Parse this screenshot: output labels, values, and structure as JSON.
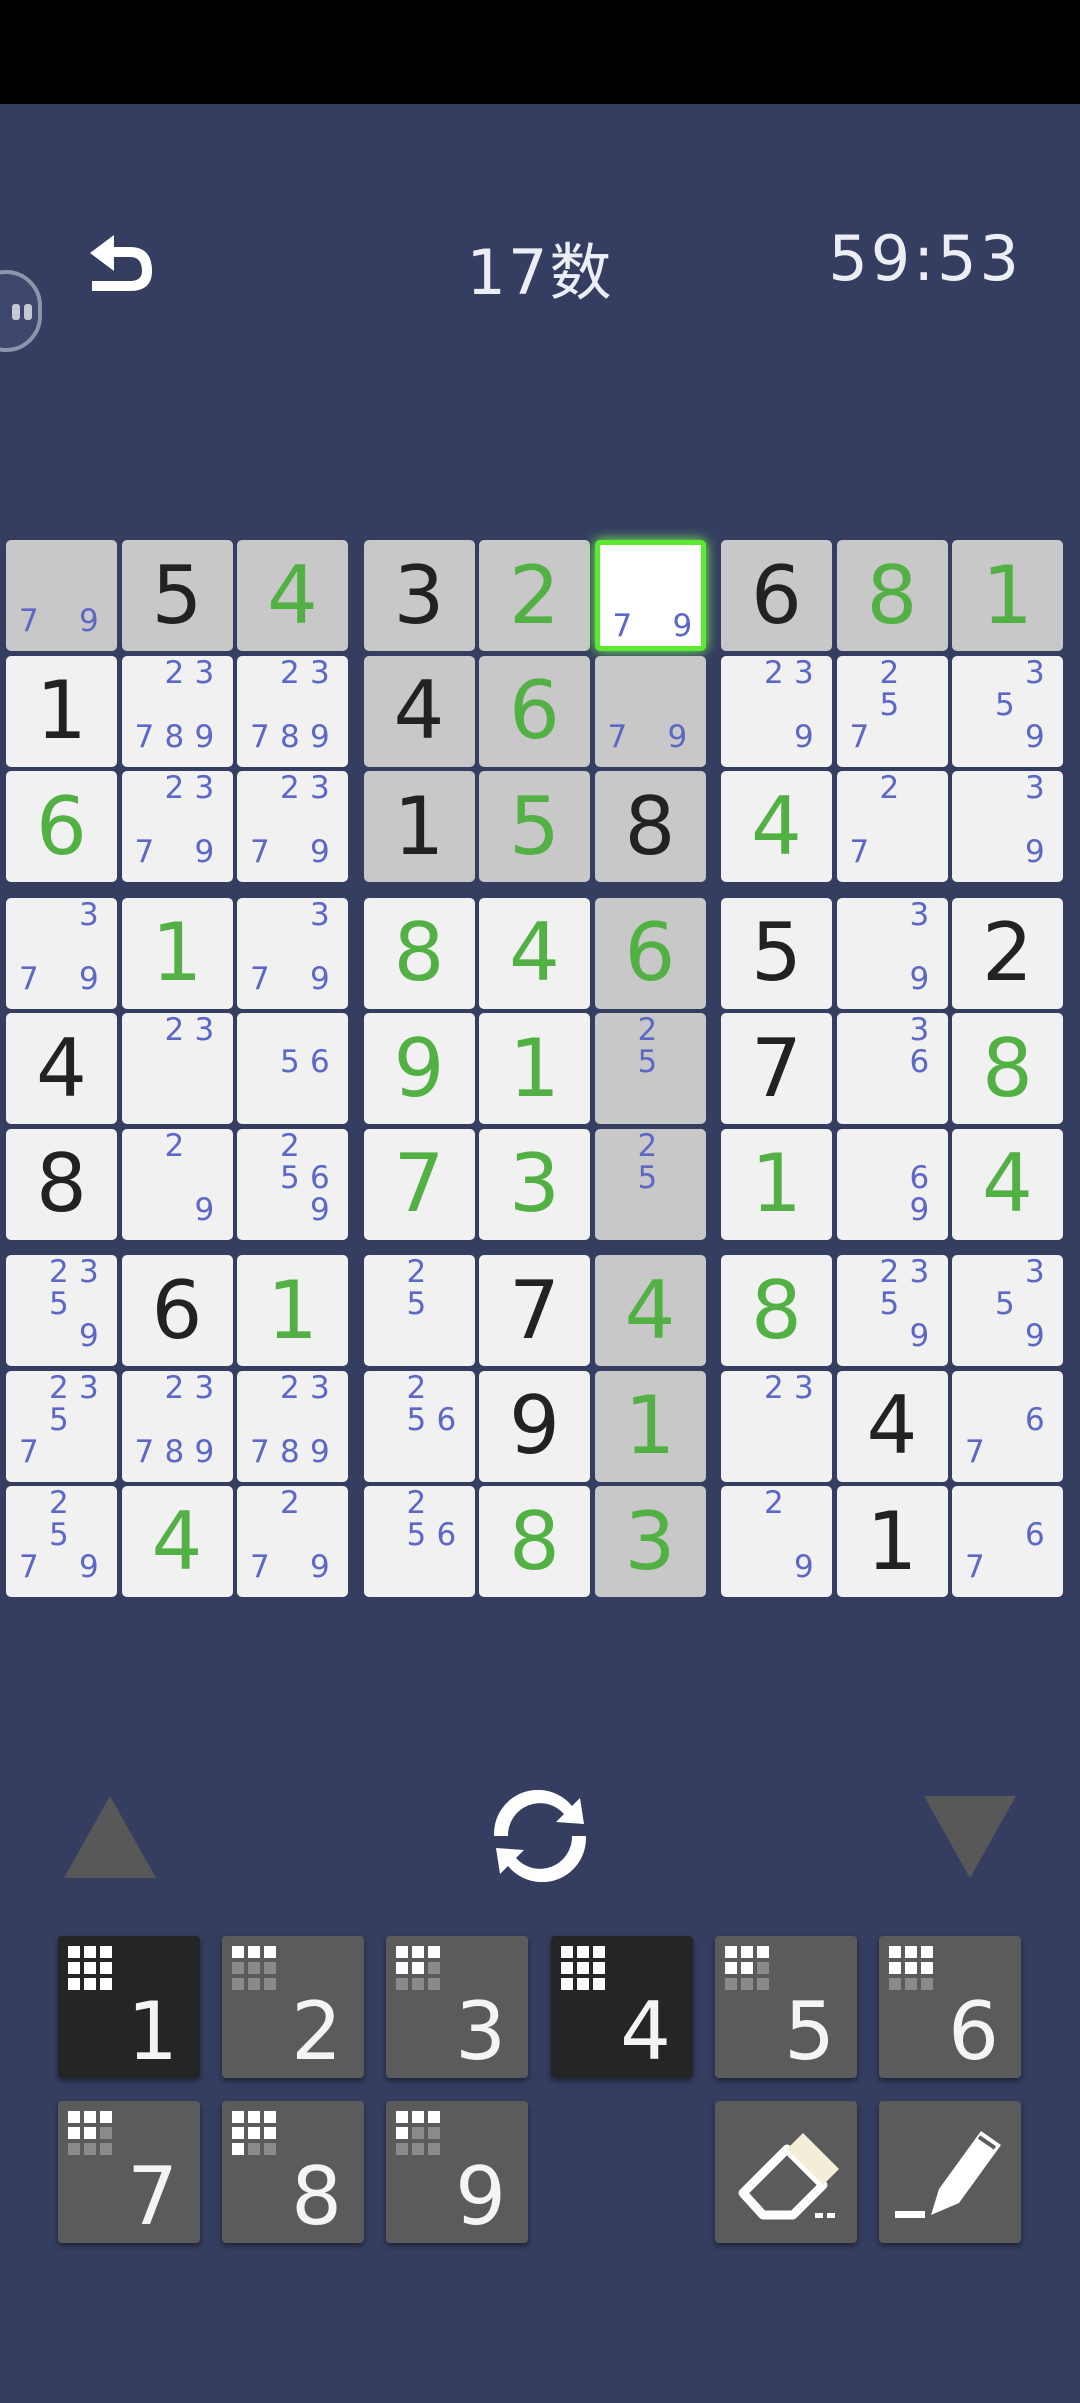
{
  "header": {
    "title": "17数",
    "timer": "59:53",
    "back_icon": "undo-arrow-icon",
    "side_icon": "floating-handle-icon"
  },
  "colors": {
    "background": "#353e61",
    "given_digit": "#222222",
    "player_digit": "#53b044",
    "candidate": "#5d68c5",
    "selected_border": "#5cea30"
  },
  "board": {
    "selected": [
      0,
      5
    ],
    "highlight_digit": "4",
    "grid": [
      [
        {
          "c": [
            7,
            9
          ],
          "s": 1
        },
        {
          "v": "5",
          "s": 1
        },
        {
          "v": "4",
          "p": 1,
          "s": 1
        },
        {
          "v": "3",
          "s": 1
        },
        {
          "v": "2",
          "p": 1,
          "s": 1
        },
        {
          "c": [
            7,
            9
          ],
          "sel": 1
        },
        {
          "v": "6",
          "s": 1
        },
        {
          "v": "8",
          "p": 1,
          "s": 1
        },
        {
          "v": "1",
          "p": 1,
          "s": 1
        }
      ],
      [
        {
          "v": "1"
        },
        {
          "c": [
            2,
            3,
            7,
            8,
            9
          ]
        },
        {
          "c": [
            2,
            3,
            7,
            8,
            9
          ]
        },
        {
          "v": "4",
          "s": 1
        },
        {
          "v": "6",
          "p": 1,
          "s": 1
        },
        {
          "c": [
            7,
            9
          ],
          "s": 1
        },
        {
          "c": [
            2,
            3,
            9
          ]
        },
        {
          "c": [
            2,
            5,
            7
          ]
        },
        {
          "c": [
            3,
            5,
            9
          ]
        }
      ],
      [
        {
          "v": "6",
          "p": 1
        },
        {
          "c": [
            2,
            3,
            7,
            9
          ]
        },
        {
          "c": [
            2,
            3,
            7,
            9
          ]
        },
        {
          "v": "1",
          "s": 1
        },
        {
          "v": "5",
          "p": 1,
          "s": 1
        },
        {
          "v": "8",
          "s": 1
        },
        {
          "v": "4",
          "p": 1
        },
        {
          "c": [
            2,
            7
          ]
        },
        {
          "c": [
            3,
            9
          ]
        }
      ],
      [
        {
          "c": [
            3,
            7,
            9
          ]
        },
        {
          "v": "1",
          "p": 1
        },
        {
          "c": [
            3,
            7,
            9
          ]
        },
        {
          "v": "8",
          "p": 1
        },
        {
          "v": "4",
          "p": 1
        },
        {
          "v": "6",
          "p": 1,
          "s": 1
        },
        {
          "v": "5"
        },
        {
          "c": [
            3,
            9
          ]
        },
        {
          "v": "2"
        }
      ],
      [
        {
          "v": "4"
        },
        {
          "c": [
            2,
            3
          ]
        },
        {
          "c": [
            5,
            6
          ]
        },
        {
          "v": "9",
          "p": 1
        },
        {
          "v": "1",
          "p": 1
        },
        {
          "c": [
            2,
            5
          ],
          "s": 1
        },
        {
          "v": "7"
        },
        {
          "c": [
            3,
            6
          ]
        },
        {
          "v": "8",
          "p": 1
        }
      ],
      [
        {
          "v": "8"
        },
        {
          "c": [
            2,
            9
          ]
        },
        {
          "c": [
            2,
            5,
            6,
            9
          ]
        },
        {
          "v": "7",
          "p": 1
        },
        {
          "v": "3",
          "p": 1
        },
        {
          "c": [
            2,
            5
          ],
          "s": 1
        },
        {
          "v": "1",
          "p": 1
        },
        {
          "c": [
            6,
            9
          ]
        },
        {
          "v": "4",
          "p": 1
        }
      ],
      [
        {
          "c": [
            2,
            3,
            5,
            9
          ]
        },
        {
          "v": "6"
        },
        {
          "v": "1",
          "p": 1
        },
        {
          "c": [
            2,
            5
          ]
        },
        {
          "v": "7"
        },
        {
          "v": "4",
          "p": 1,
          "s": 1
        },
        {
          "v": "8",
          "p": 1
        },
        {
          "c": [
            2,
            3,
            5,
            9
          ]
        },
        {
          "c": [
            3,
            5,
            9
          ]
        }
      ],
      [
        {
          "c": [
            2,
            3,
            5,
            7
          ]
        },
        {
          "c": [
            2,
            3,
            7,
            8,
            9
          ]
        },
        {
          "c": [
            2,
            3,
            7,
            8,
            9
          ]
        },
        {
          "c": [
            2,
            5,
            6
          ]
        },
        {
          "v": "9"
        },
        {
          "v": "1",
          "p": 1,
          "s": 1
        },
        {
          "c": [
            2,
            3
          ]
        },
        {
          "v": "4"
        },
        {
          "c": [
            6,
            7
          ]
        }
      ],
      [
        {
          "c": [
            2,
            5,
            7,
            9
          ]
        },
        {
          "v": "4",
          "p": 1
        },
        {
          "c": [
            2,
            7,
            9
          ]
        },
        {
          "c": [
            2,
            5,
            6
          ]
        },
        {
          "v": "8",
          "p": 1
        },
        {
          "v": "3",
          "p": 1,
          "s": 1
        },
        {
          "c": [
            2,
            9
          ]
        },
        {
          "v": "1"
        },
        {
          "c": [
            6,
            7
          ]
        }
      ]
    ]
  },
  "controls": {
    "up_icon": "triangle-up-icon",
    "cycle_icon": "refresh-cycle-icon",
    "down_icon": "triangle-down-icon"
  },
  "number_pad": [
    {
      "label": "1",
      "remaining": 9,
      "dark": true
    },
    {
      "label": "2",
      "remaining": 3,
      "dark": false
    },
    {
      "label": "3",
      "remaining": 5,
      "dark": false
    },
    {
      "label": "4",
      "remaining": 9,
      "dark": true
    },
    {
      "label": "5",
      "remaining": 5,
      "dark": false
    },
    {
      "label": "6",
      "remaining": 6,
      "dark": false
    },
    {
      "label": "7",
      "remaining": 5,
      "dark": false
    },
    {
      "label": "8",
      "remaining": 7,
      "dark": false
    },
    {
      "label": "9",
      "remaining": 4,
      "dark": false
    }
  ],
  "tools": {
    "eraser_icon": "eraser-icon",
    "pencil_icon": "pencil-notes-icon"
  }
}
